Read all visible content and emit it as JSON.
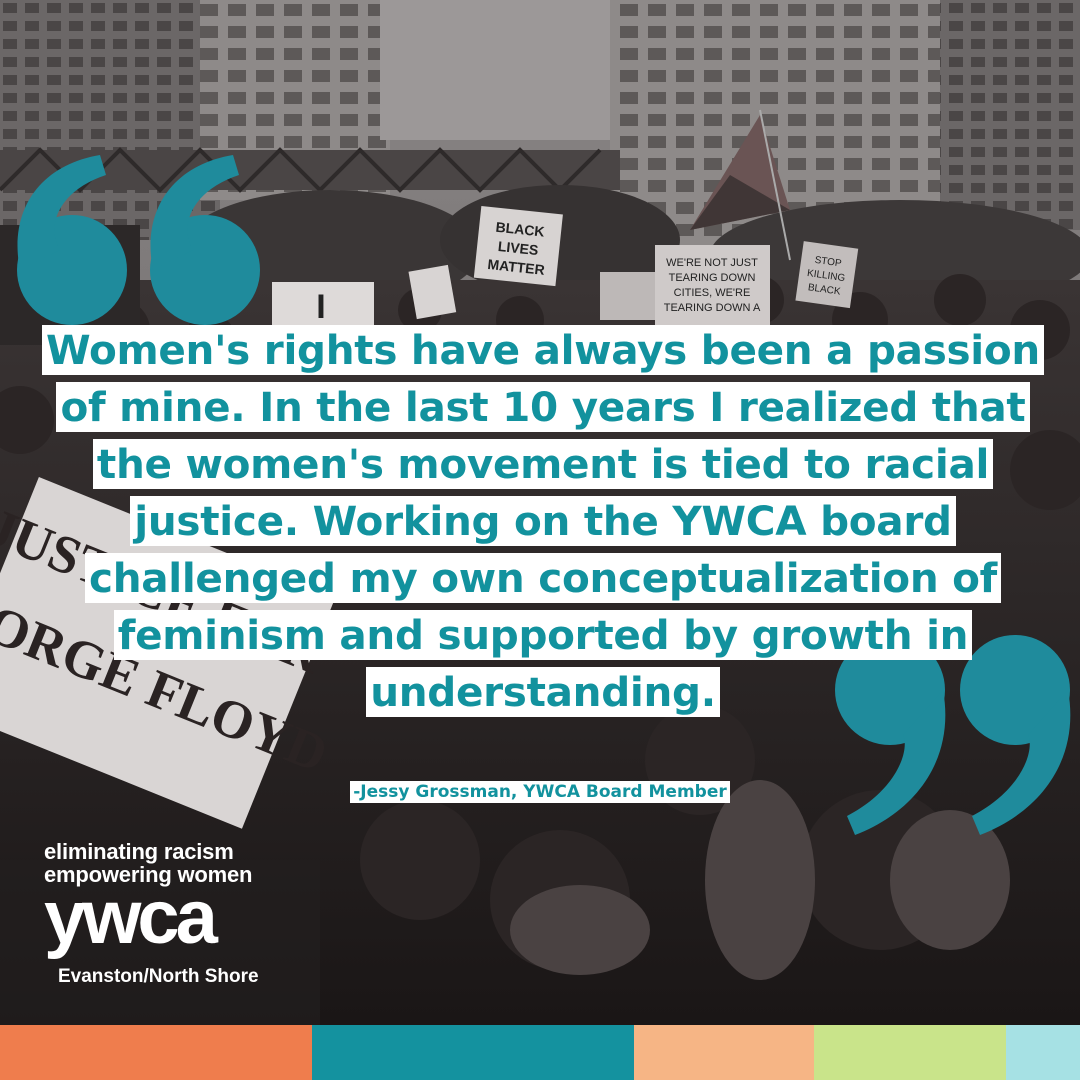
{
  "quote": {
    "text": "Women's rights have always been a passion of mine. In the last 10 years I realized that the women's movement is tied to racial justice. Working on the YWCA board challenged my own conceptualization of feminism and supported by growth in understanding.",
    "attribution": "-Jessy Grossman, YWCA Board Member"
  },
  "signs": {
    "black_lives_matter": "BLACK LIVES MATTER",
    "tearing_down": "WE'RE NOT JUST TEARING DOWN CITIES, WE'RE TEARING DOWN A",
    "stop_killing": "STOP KILLING BLACK PEOPLE",
    "banner": "JUSTICE FOR GEORGE FLOYD",
    "letter": "I"
  },
  "logo": {
    "tagline_line1": "eliminating racism",
    "tagline_line2": "empowering women",
    "wordmark": "ywca",
    "chapter": "Evanston/North Shore"
  },
  "colors": {
    "teal_text": "#12929e",
    "quote_marks": "#1f8b9c",
    "stripes": [
      "#ef7d4d",
      "#14929f",
      "#f6b585",
      "#c9e48a",
      "#a6e1e4"
    ]
  },
  "icons": {
    "open_quote": "open-quote-icon",
    "close_quote": "close-quote-icon"
  }
}
